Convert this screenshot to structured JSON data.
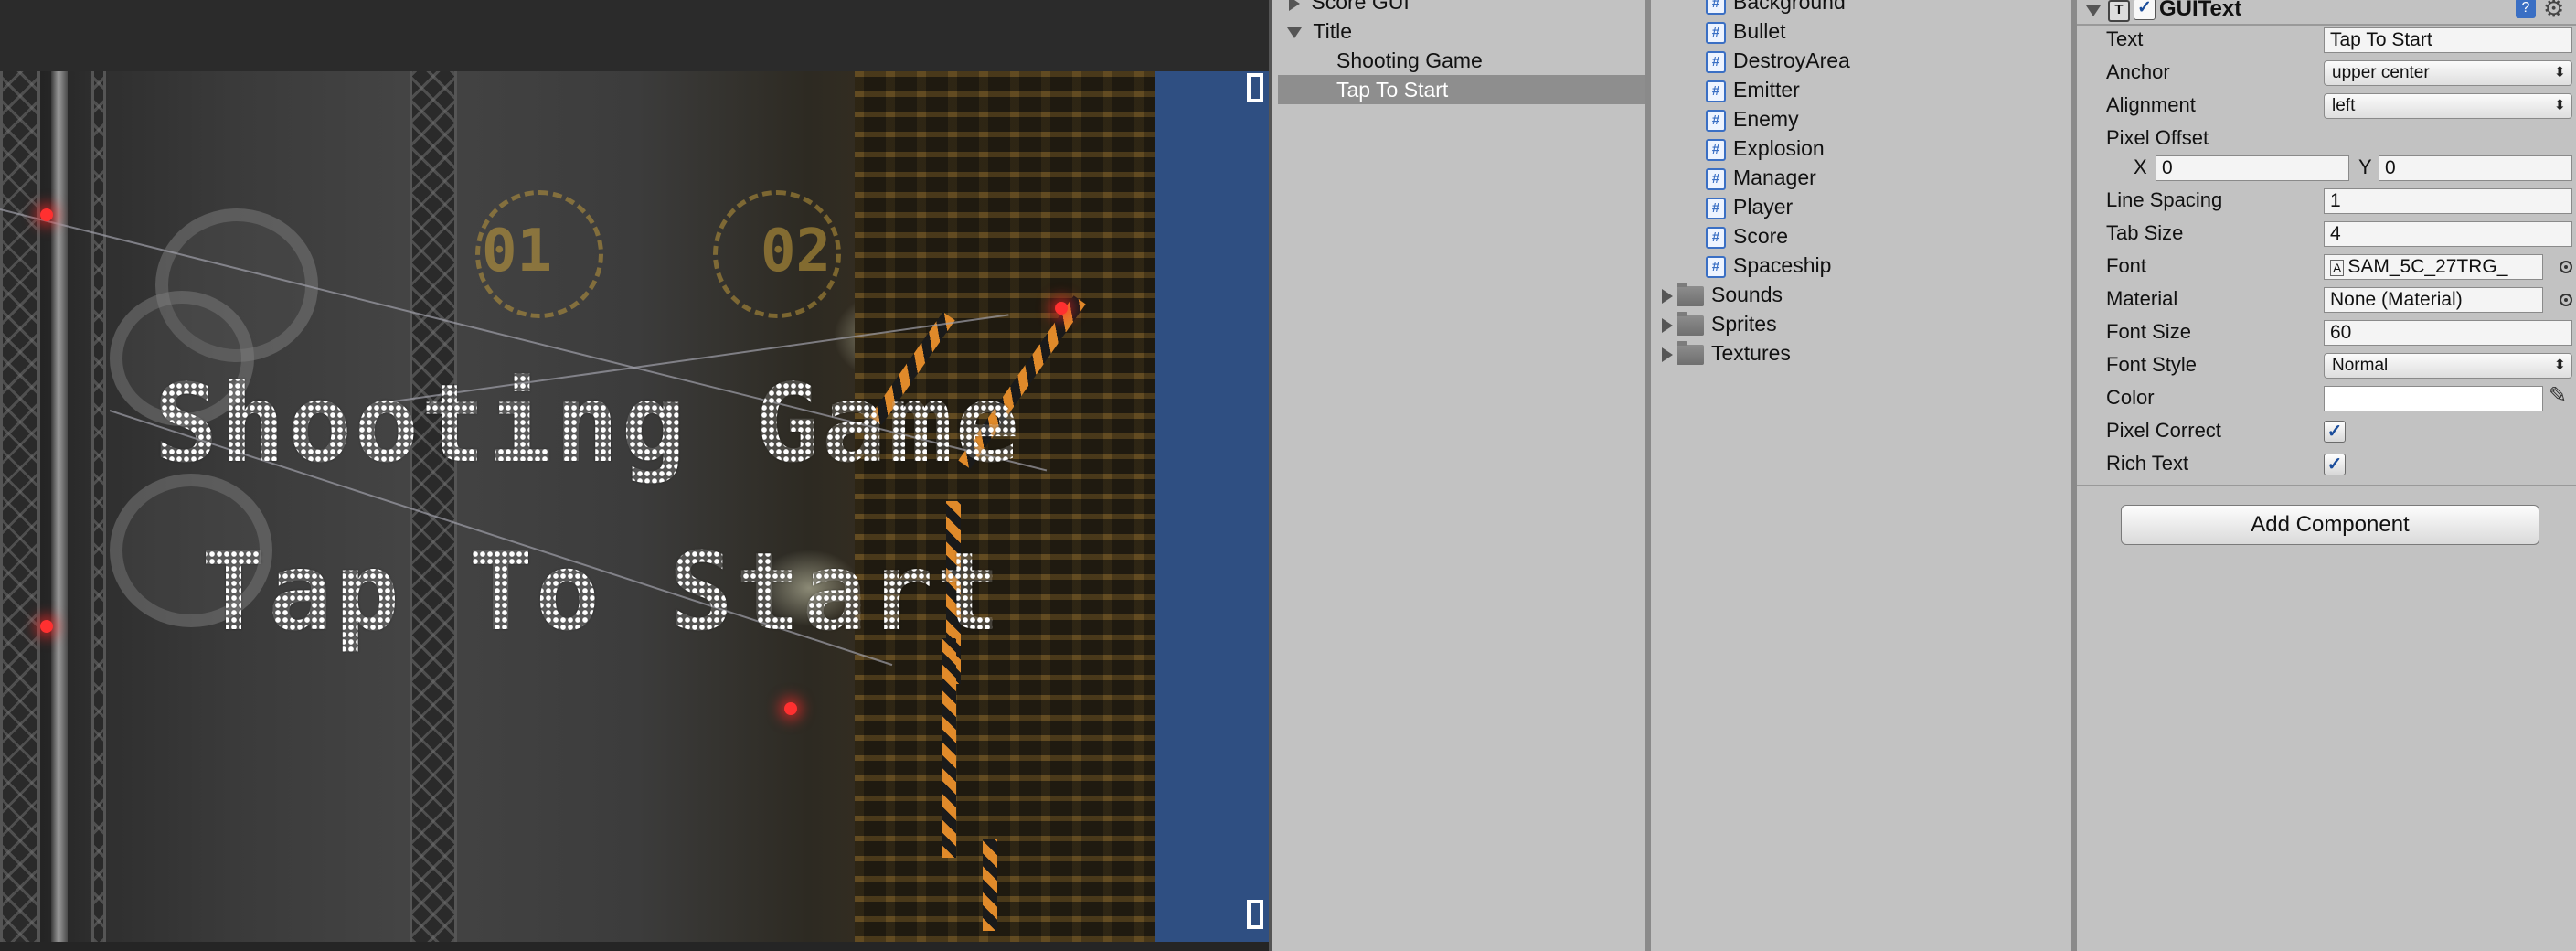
{
  "game": {
    "title_line": "Shooting Game",
    "subtitle_line": "Tap To Start",
    "floor_numbers": [
      "01",
      "02"
    ]
  },
  "hierarchy": {
    "items": [
      {
        "label": "Score GUI",
        "expander": "right",
        "selected": false
      },
      {
        "label": "Title",
        "expander": "down",
        "selected": false
      },
      {
        "label": "Shooting Game",
        "expander": "none",
        "selected": false
      },
      {
        "label": "Tap To Start",
        "expander": "none",
        "selected": true
      }
    ]
  },
  "project": {
    "scripts": [
      "Background",
      "Bullet",
      "DestroyArea",
      "Emitter",
      "Enemy",
      "Explosion",
      "Manager",
      "Player",
      "Score",
      "Spaceship"
    ],
    "folders": [
      "Sounds",
      "Sprites",
      "Textures"
    ],
    "script_icon": "csharp-script-icon",
    "folder_icon": "folder-icon"
  },
  "inspector": {
    "component_name": "GUIText",
    "component_enabled": true,
    "text_label": "Text",
    "text_value": "Tap To Start",
    "anchor_label": "Anchor",
    "anchor_value": "upper center",
    "alignment_label": "Alignment",
    "alignment_value": "left",
    "pixel_offset_label": "Pixel Offset",
    "pixel_offset_x_label": "X",
    "pixel_offset_x": "0",
    "pixel_offset_y_label": "Y",
    "pixel_offset_y": "0",
    "line_spacing_label": "Line Spacing",
    "line_spacing_value": "1",
    "tab_size_label": "Tab Size",
    "tab_size_value": "4",
    "font_label": "Font",
    "font_value": "SAM_5C_27TRG_",
    "material_label": "Material",
    "material_value": "None (Material)",
    "font_size_label": "Font Size",
    "font_size_value": "60",
    "font_style_label": "Font Style",
    "font_style_value": "Normal",
    "color_label": "Color",
    "color_value": "#ffffff",
    "pixel_correct_label": "Pixel Correct",
    "pixel_correct": true,
    "rich_text_label": "Rich Text",
    "rich_text": true,
    "add_component_label": "Add Component"
  },
  "colors": {
    "panel_bg": "#c2c2c2",
    "selection": "#8e8e8e",
    "game_blue": "#2f4f82"
  }
}
